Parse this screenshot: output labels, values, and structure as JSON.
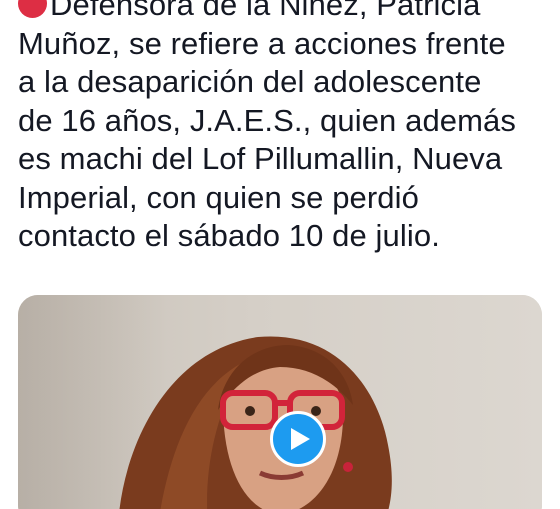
{
  "tweet": {
    "text_lines": [
      "Defensora de la Niñez, Patricia",
      "Muñoz, se refiere a acciones frente",
      "a la desaparición del adolescente",
      "de 16 años, J.A.E.S., quien además",
      "es machi del Lof Pillumallin, Nueva",
      "Imperial, con quien se perdió",
      "contacto el sábado 10 de julio."
    ],
    "emoji_icon": "red-circle-icon"
  },
  "media": {
    "type": "video",
    "play_icon": "play-icon",
    "accent_color": "#1d9bf0"
  },
  "colors": {
    "text": "#141823",
    "emoji_red": "#dd2e44",
    "background": "#ffffff"
  }
}
